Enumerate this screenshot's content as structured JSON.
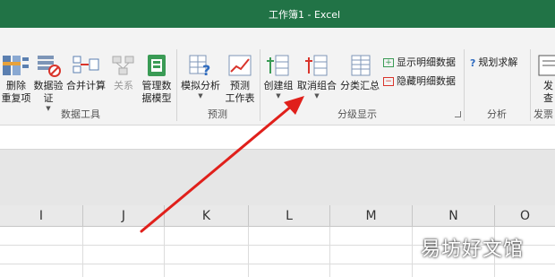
{
  "window": {
    "title": "工作簿1 - Excel"
  },
  "ribbon": {
    "data_tools": {
      "group_label": "数据工具",
      "remove_duplicates": [
        "删除",
        "重复项"
      ],
      "data_validation": [
        "数据验",
        "证"
      ],
      "consolidate": "合并计算",
      "relationships": "关系",
      "manage_data_model": [
        "管理数",
        "据模型"
      ]
    },
    "forecast": {
      "group_label": "预测",
      "what_if": [
        "模拟分析"
      ],
      "forecast_sheet": [
        "预测",
        "工作表"
      ]
    },
    "outline": {
      "group_label": "分级显示",
      "group": "创建组",
      "ungroup": "取消组合",
      "subtotal": "分类汇总",
      "show_detail": "显示明细数据",
      "hide_detail": "隐藏明细数据"
    },
    "analysis": {
      "group_label": "分析",
      "solver": "规划求解"
    },
    "publish": {
      "group_label": "发票",
      "button": [
        "发",
        "查"
      ]
    }
  },
  "columns": [
    "I",
    "J",
    "K",
    "L",
    "M",
    "N",
    "O"
  ],
  "watermark": "易坊好文馆",
  "colors": {
    "title_bar": "#217346",
    "arrow": "#e0201b"
  }
}
